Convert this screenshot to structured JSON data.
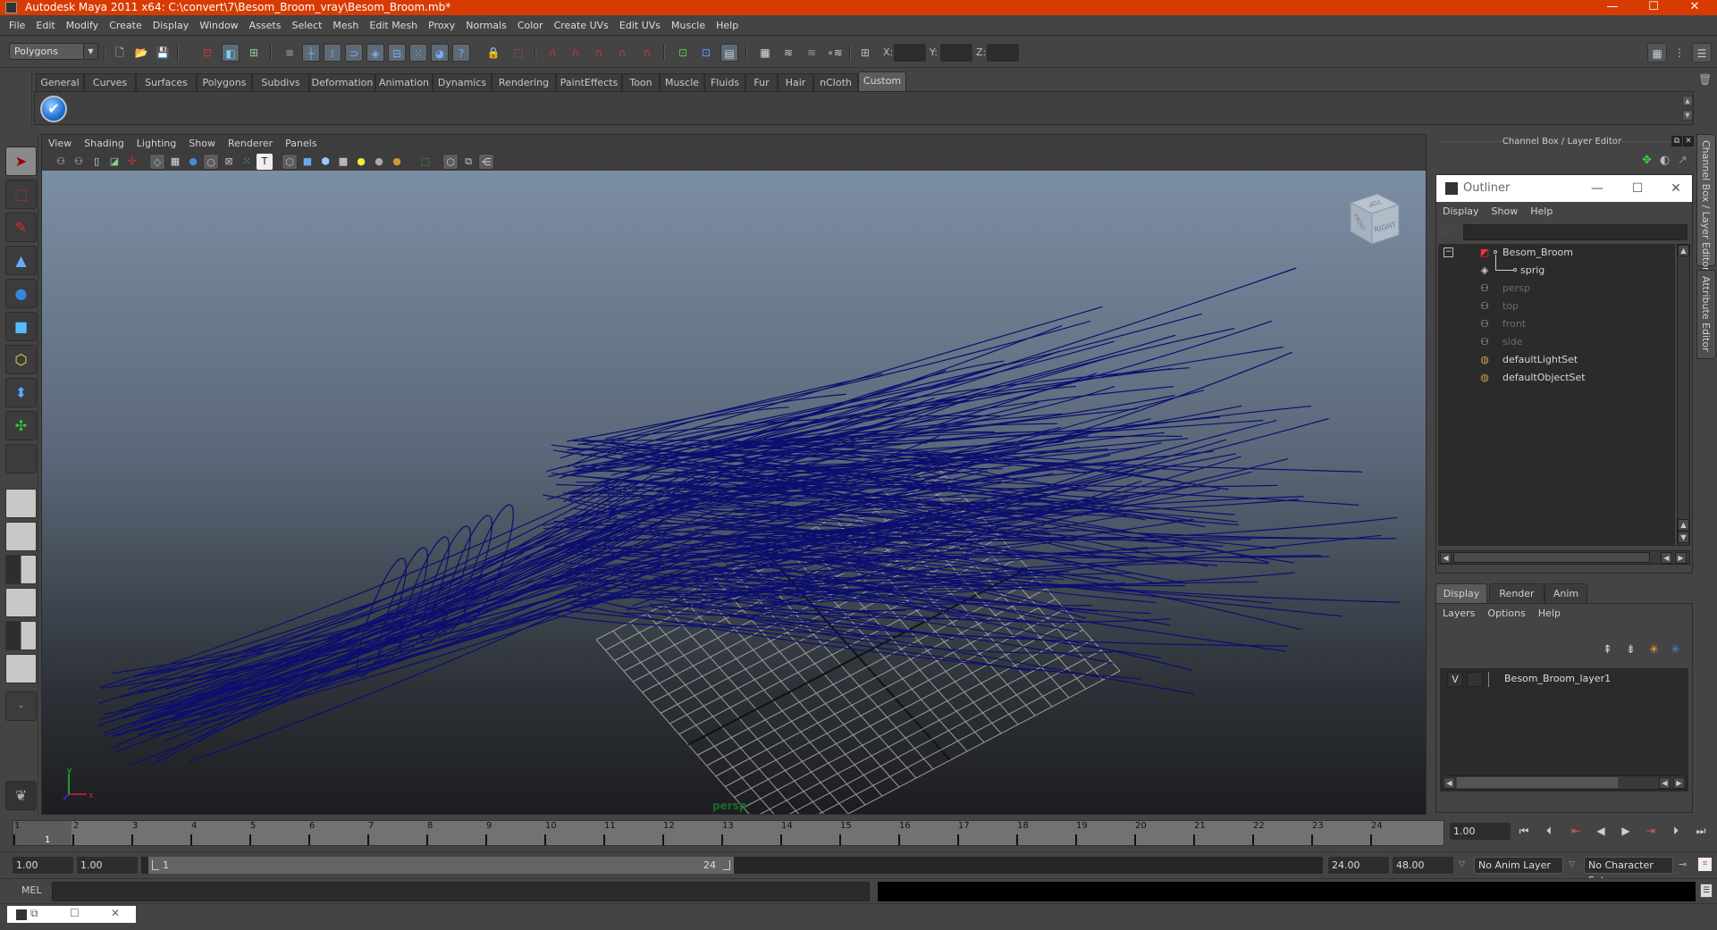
{
  "window": {
    "title": "Autodesk Maya 2011 x64: C:\\convert\\7\\Besom_Broom_vray\\Besom_Broom.mb*",
    "minimize": "—",
    "maximize": "☐",
    "close": "✕",
    "accent_color": "#d83b01"
  },
  "menubar": [
    "File",
    "Edit",
    "Modify",
    "Create",
    "Display",
    "Window",
    "Assets",
    "Select",
    "Mesh",
    "Edit Mesh",
    "Proxy",
    "Normals",
    "Color",
    "Create UVs",
    "Edit UVs",
    "Muscle",
    "Help"
  ],
  "statusline": {
    "mode": "Polygons",
    "x_label": "X:",
    "y_label": "Y:",
    "z_label": "Z:",
    "x_value": "",
    "y_value": "",
    "z_value": ""
  },
  "shelf": {
    "tabs": [
      "General",
      "Curves",
      "Surfaces",
      "Polygons",
      "Subdivs",
      "Deformation",
      "Animation",
      "Dynamics",
      "Rendering",
      "PaintEffects",
      "Toon",
      "Muscle",
      "Fluids",
      "Fur",
      "Hair",
      "nCloth",
      "Custom"
    ],
    "active_tab": "Custom",
    "buttons": [
      {
        "icon": "checkmark-icon",
        "glyph": "✔"
      }
    ]
  },
  "toolbox": {
    "tools": [
      {
        "name": "select-tool",
        "glyph": "➤"
      },
      {
        "name": "lasso-tool",
        "glyph": "⬚"
      },
      {
        "name": "paint-select-tool",
        "glyph": "✎"
      },
      {
        "name": "move-tool",
        "glyph": "▲"
      },
      {
        "name": "rotate-tool",
        "glyph": "●"
      },
      {
        "name": "scale-tool",
        "glyph": "■"
      },
      {
        "name": "universal-manipulator",
        "glyph": "⬡"
      },
      {
        "name": "soft-modification-tool",
        "glyph": "⬍"
      },
      {
        "name": "show-manipulator-tool",
        "glyph": "✣"
      },
      {
        "name": "last-tool",
        "glyph": ""
      }
    ]
  },
  "viewport": {
    "menu": [
      "View",
      "Shading",
      "Lighting",
      "Show",
      "Renderer",
      "Panels"
    ],
    "camera_label": "persp",
    "viewcube": {
      "top": "TOP",
      "front": "FRONT",
      "right": "RIGHT"
    },
    "axis": {
      "x": "x",
      "y": "y"
    }
  },
  "channel_box": {
    "header": "Channel Box / Layer Editor"
  },
  "outliner": {
    "title": "Outliner",
    "menu": [
      "Display",
      "Show",
      "Help"
    ],
    "filter_value": "",
    "items": [
      {
        "label": "Besom_Broom",
        "icon": "transform-icon",
        "dim": false,
        "indent": 0
      },
      {
        "label": "sprig",
        "icon": "mesh-icon",
        "dim": false,
        "indent": 1
      },
      {
        "label": "persp",
        "icon": "camera-icon",
        "dim": true,
        "indent": 0
      },
      {
        "label": "top",
        "icon": "camera-icon",
        "dim": true,
        "indent": 0
      },
      {
        "label": "front",
        "icon": "camera-icon",
        "dim": true,
        "indent": 0
      },
      {
        "label": "side",
        "icon": "camera-icon",
        "dim": true,
        "indent": 0
      },
      {
        "label": "defaultLightSet",
        "icon": "set-icon",
        "dim": false,
        "indent": 0
      },
      {
        "label": "defaultObjectSet",
        "icon": "set-icon",
        "dim": false,
        "indent": 0
      }
    ]
  },
  "layer_editor": {
    "tabs": [
      "Display",
      "Render",
      "Anim"
    ],
    "active_tab": "Display",
    "menu": [
      "Layers",
      "Options",
      "Help"
    ],
    "layers": [
      {
        "visible": "V",
        "template": "",
        "name": "Besom_Broom_layer1"
      }
    ]
  },
  "side_tabs": [
    "Channel Box / Layer Editor",
    "Attribute Editor"
  ],
  "timeline": {
    "ticks": [
      "1",
      "2",
      "3",
      "4",
      "5",
      "6",
      "7",
      "8",
      "9",
      "10",
      "11",
      "12",
      "13",
      "14",
      "15",
      "16",
      "17",
      "18",
      "19",
      "20",
      "21",
      "22",
      "23",
      "24"
    ],
    "current_frame_marker": "1",
    "current_frame": "1.00",
    "playback_buttons": [
      {
        "name": "go-to-start",
        "glyph": "⏮"
      },
      {
        "name": "step-back-frame",
        "glyph": "⏴"
      },
      {
        "name": "step-back-key",
        "glyph": "⇤"
      },
      {
        "name": "play-backwards",
        "glyph": "◀"
      },
      {
        "name": "play-forwards",
        "glyph": "▶"
      },
      {
        "name": "step-forward-key",
        "glyph": "⇥"
      },
      {
        "name": "step-forward-frame",
        "glyph": "⏵"
      },
      {
        "name": "go-to-end",
        "glyph": "⏭"
      }
    ]
  },
  "range": {
    "start_time": "1.00",
    "playback_start": "1.00",
    "range_start_label": "1",
    "range_end_label": "24",
    "playback_end": "24.00",
    "end_time": "48.00",
    "anim_layer": "No Anim Layer",
    "character_set": "No Character Set"
  },
  "command_line": {
    "label": "MEL",
    "value": "",
    "result": ""
  }
}
